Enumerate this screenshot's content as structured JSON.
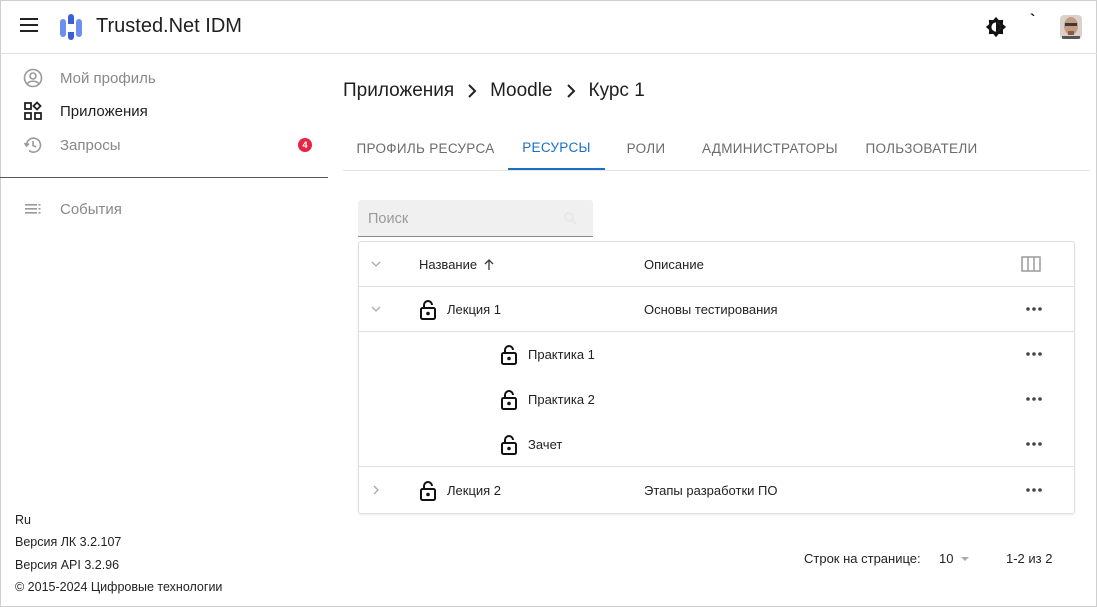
{
  "app": {
    "title": "Trusted.Net IDM"
  },
  "header": {
    "lang_label": "`"
  },
  "sidebar": {
    "items": [
      {
        "label": "Мой профиль",
        "icon": "account-circle-icon"
      },
      {
        "label": "Приложения",
        "icon": "apps-icon"
      },
      {
        "label": "Запросы",
        "icon": "history-icon",
        "badge": "4"
      },
      {
        "label": "События",
        "icon": "list-icon"
      }
    ],
    "footer": {
      "lang": "Ru",
      "version_lk": "Версия ЛК 3.2.107",
      "version_api": "Версия API 3.2.96",
      "copyright": "© 2015-2024 Цифровые технологии"
    }
  },
  "breadcrumb": [
    "Приложения",
    "Moodle",
    "Курс 1"
  ],
  "tabs": [
    "ПРОФИЛЬ РЕСУРСА",
    "РЕСУРСЫ",
    "РОЛИ",
    "АДМИНИСТРАТОРЫ",
    "ПОЛЬЗОВАТЕЛИ"
  ],
  "active_tab": "РЕСУРСЫ",
  "search": {
    "placeholder": "Поиск",
    "value": ""
  },
  "table": {
    "columns": [
      "Название",
      "Описание"
    ],
    "rows": [
      {
        "name": "Лекция 1",
        "description": "Основы тестирования"
      },
      {
        "name": "Практика 1",
        "description": ""
      },
      {
        "name": "Практика 2",
        "description": ""
      },
      {
        "name": "Зачет",
        "description": ""
      },
      {
        "name": "Лекция 2",
        "description": "Этапы разработки ПО"
      }
    ]
  },
  "pagination": {
    "rows_per_page_label": "Строк на странице:",
    "rows_per_page": "10",
    "range": "1-2 из 2"
  },
  "colors": {
    "accent": "#1a6fc7",
    "badge": "#e52545",
    "logo": "#4a6fe0"
  }
}
